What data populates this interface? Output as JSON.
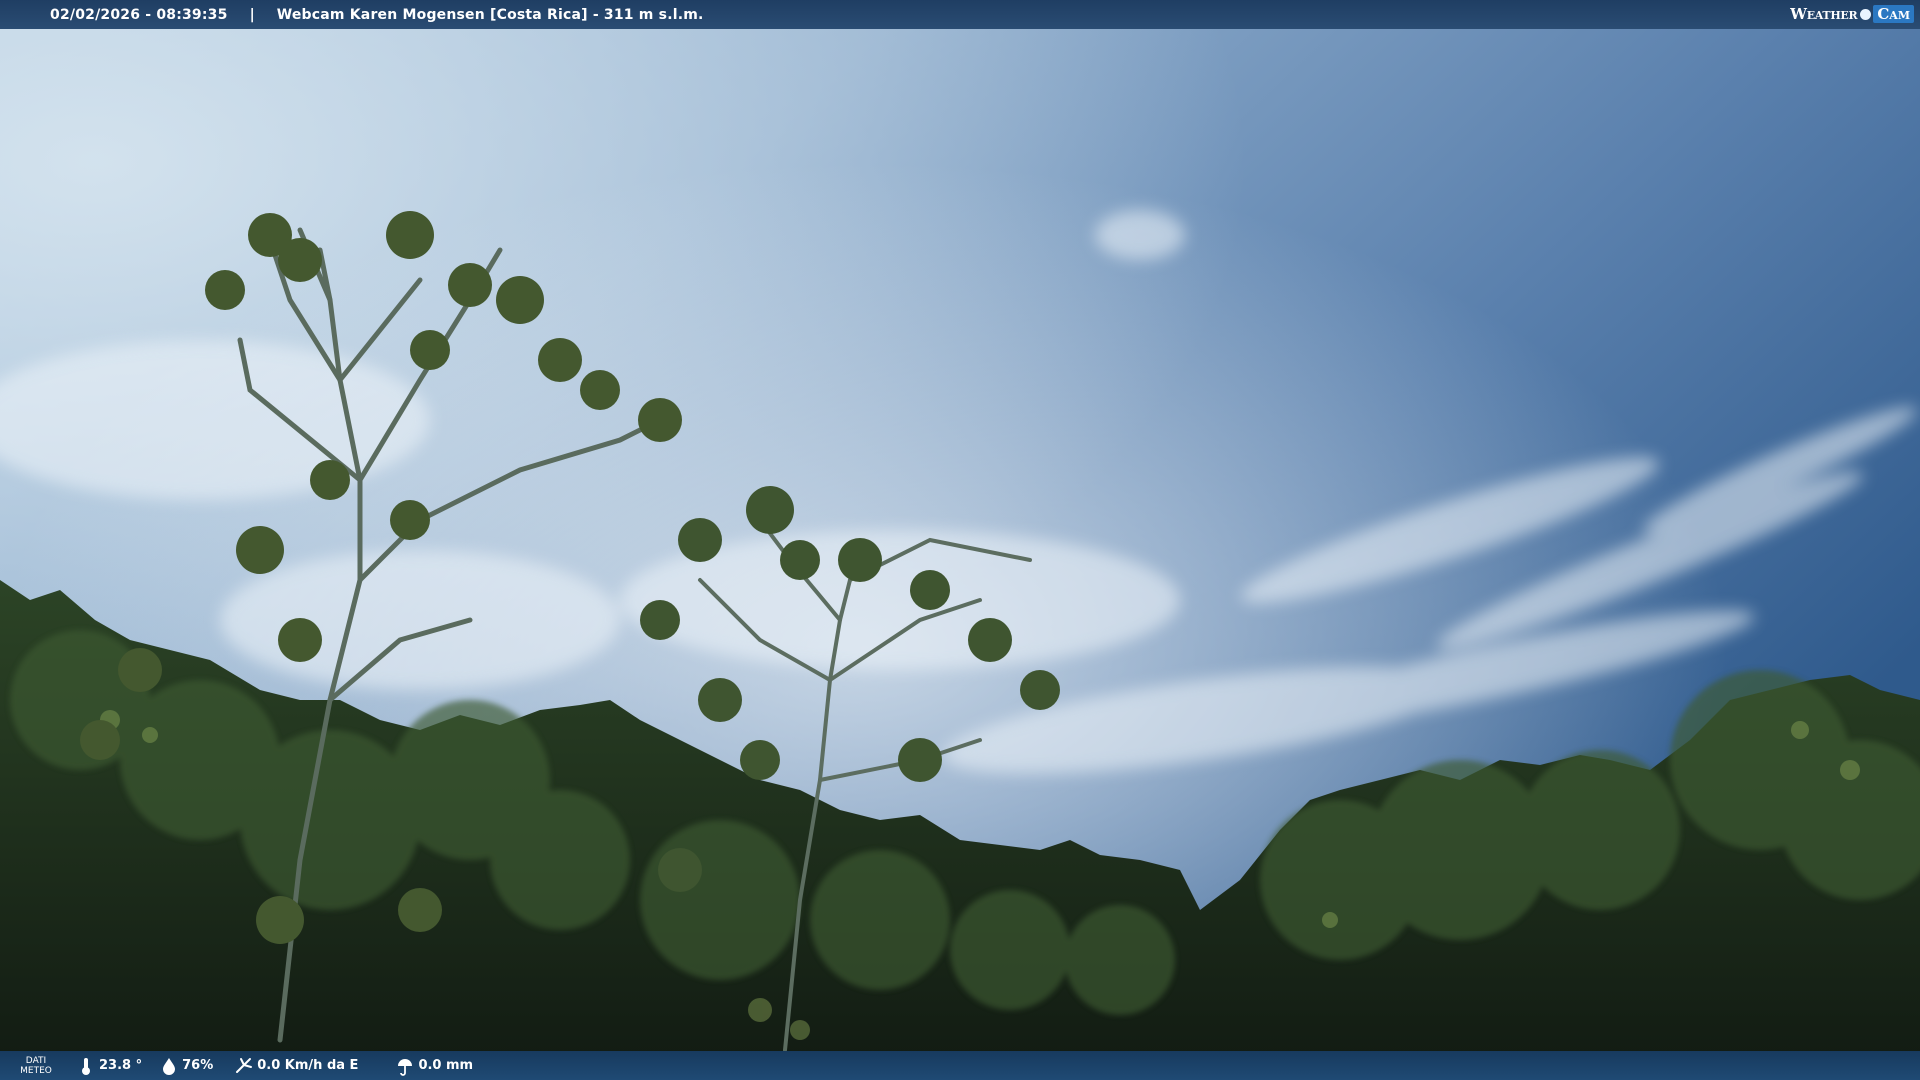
{
  "header": {
    "datetime": "02/02/2026 - 08:39:35",
    "separator": "|",
    "title": "Webcam Karen Mogensen [Costa Rica]  - 311 m s.l.m.",
    "logo_left": "Weather",
    "logo_right": "Cam"
  },
  "weather": {
    "label_line1": "DATI",
    "label_line2": "METEO",
    "temperature": "23.8 °",
    "humidity": "76%",
    "wind": "0.0 Km/h da E",
    "rain": "0.0 mm"
  },
  "icons": [
    "thermometer-icon",
    "humidity-icon",
    "wind-icon",
    "rain-icon"
  ],
  "colors": {
    "bar": "#1f3e63",
    "sky_top": "#3d6694",
    "sky_light": "#c7d8e6",
    "foliage": "#1d2d1c"
  }
}
